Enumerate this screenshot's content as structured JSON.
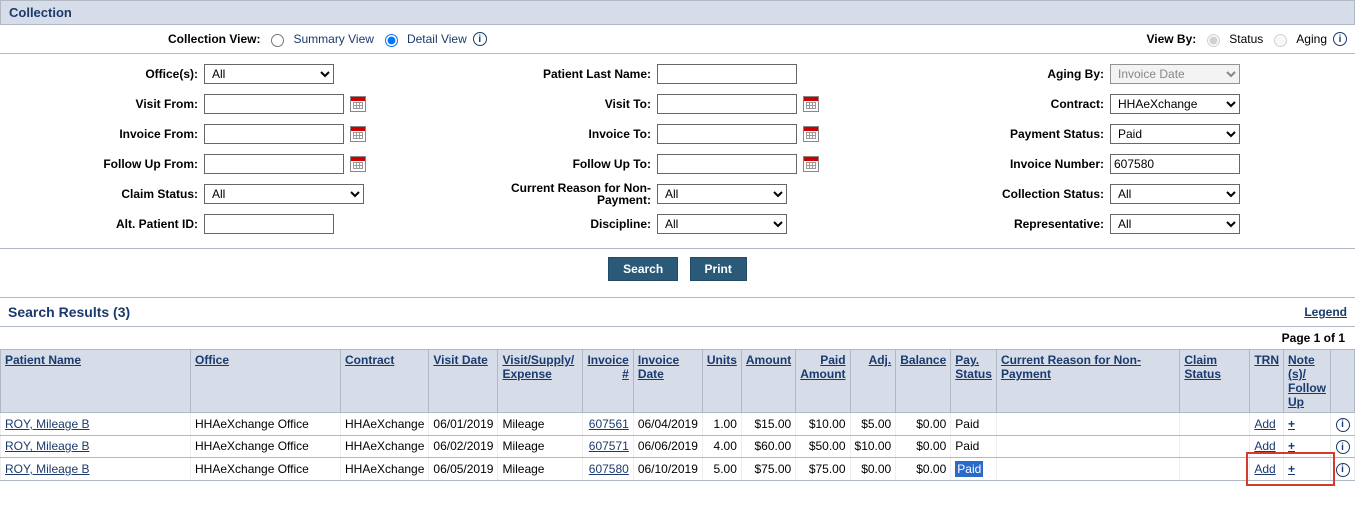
{
  "header": {
    "title": "Collection"
  },
  "viewbar": {
    "collection_view_label": "Collection View:",
    "summary_label": "Summary View",
    "detail_label": "Detail View",
    "view_by_label": "View By:",
    "status_label": "Status",
    "aging_label": "Aging"
  },
  "filters": {
    "col1": {
      "offices_label": "Office(s):",
      "offices_value": "All",
      "visit_from_label": "Visit From:",
      "visit_from_value": "",
      "invoice_from_label": "Invoice From:",
      "invoice_from_value": "",
      "followup_from_label": "Follow Up From:",
      "followup_from_value": "",
      "claim_status_label": "Claim Status:",
      "claim_status_value": "All",
      "alt_patient_id_label": "Alt. Patient ID:",
      "alt_patient_id_value": ""
    },
    "col2": {
      "patient_last_name_label": "Patient Last Name:",
      "patient_last_name_value": "",
      "visit_to_label": "Visit To:",
      "visit_to_value": "",
      "invoice_to_label": "Invoice To:",
      "invoice_to_value": "",
      "followup_to_label": "Follow Up To:",
      "followup_to_value": "",
      "reason_nonpay_label": "Current Reason for Non-Payment:",
      "reason_nonpay_value": "All",
      "discipline_label": "Discipline:",
      "discipline_value": "All"
    },
    "col3": {
      "aging_by_label": "Aging By:",
      "aging_by_value": "Invoice Date",
      "contract_label": "Contract:",
      "contract_value": "HHAeXchange",
      "payment_status_label": "Payment Status:",
      "payment_status_value": "Paid",
      "invoice_number_label": "Invoice Number:",
      "invoice_number_value": "607580",
      "collection_status_label": "Collection Status:",
      "collection_status_value": "All",
      "representative_label": "Representative:",
      "representative_value": "All"
    }
  },
  "buttons": {
    "search": "Search",
    "print": "Print"
  },
  "results": {
    "title": "Search Results (3)",
    "legend": "Legend",
    "page_text": "Page 1 of 1",
    "cols": {
      "patient": "Patient Name",
      "office": "Office",
      "contract": "Contract",
      "visit_date": "Visit Date",
      "visit_type": "Visit/Supply/ Expense",
      "invoice_num": "Invoice #",
      "invoice_date": "Invoice Date",
      "units": "Units",
      "amount": "Amount",
      "paid_amount": "Paid Amount",
      "adj": "Adj.",
      "balance": "Balance",
      "pay_status": "Pay. Status",
      "reason": "Current Reason for Non-Payment",
      "claim_status": "Claim Status",
      "trn": "TRN",
      "notes": "Note (s)/ Follow Up",
      "info": ""
    },
    "rows": [
      {
        "patient": "ROY, Mileage B",
        "office": "HHAeXchange Office",
        "contract": "HHAeXchange",
        "visit_date": "06/01/2019",
        "visit_type": "Mileage",
        "invoice_num": "607561",
        "invoice_date": "06/04/2019",
        "units": "1.00",
        "amount": "$15.00",
        "paid_amount": "$10.00",
        "adj": "$5.00",
        "balance": "$0.00",
        "pay_status": "Paid",
        "reason": "",
        "claim_status": "",
        "trn": "Add",
        "notes": "+",
        "highlight": false
      },
      {
        "patient": "ROY, Mileage B",
        "office": "HHAeXchange Office",
        "contract": "HHAeXchange",
        "visit_date": "06/02/2019",
        "visit_type": "Mileage",
        "invoice_num": "607571",
        "invoice_date": "06/06/2019",
        "units": "4.00",
        "amount": "$60.00",
        "paid_amount": "$50.00",
        "adj": "$10.00",
        "balance": "$0.00",
        "pay_status": "Paid",
        "reason": "",
        "claim_status": "",
        "trn": "Add",
        "notes": "+",
        "highlight": false
      },
      {
        "patient": "ROY, Mileage B",
        "office": "HHAeXchange Office",
        "contract": "HHAeXchange",
        "visit_date": "06/05/2019",
        "visit_type": "Mileage",
        "invoice_num": "607580",
        "invoice_date": "06/10/2019",
        "units": "5.00",
        "amount": "$75.00",
        "paid_amount": "$75.00",
        "adj": "$0.00",
        "balance": "$0.00",
        "pay_status": "Paid",
        "reason": "",
        "claim_status": "",
        "trn": "Add",
        "notes": "+",
        "highlight": true
      }
    ]
  }
}
